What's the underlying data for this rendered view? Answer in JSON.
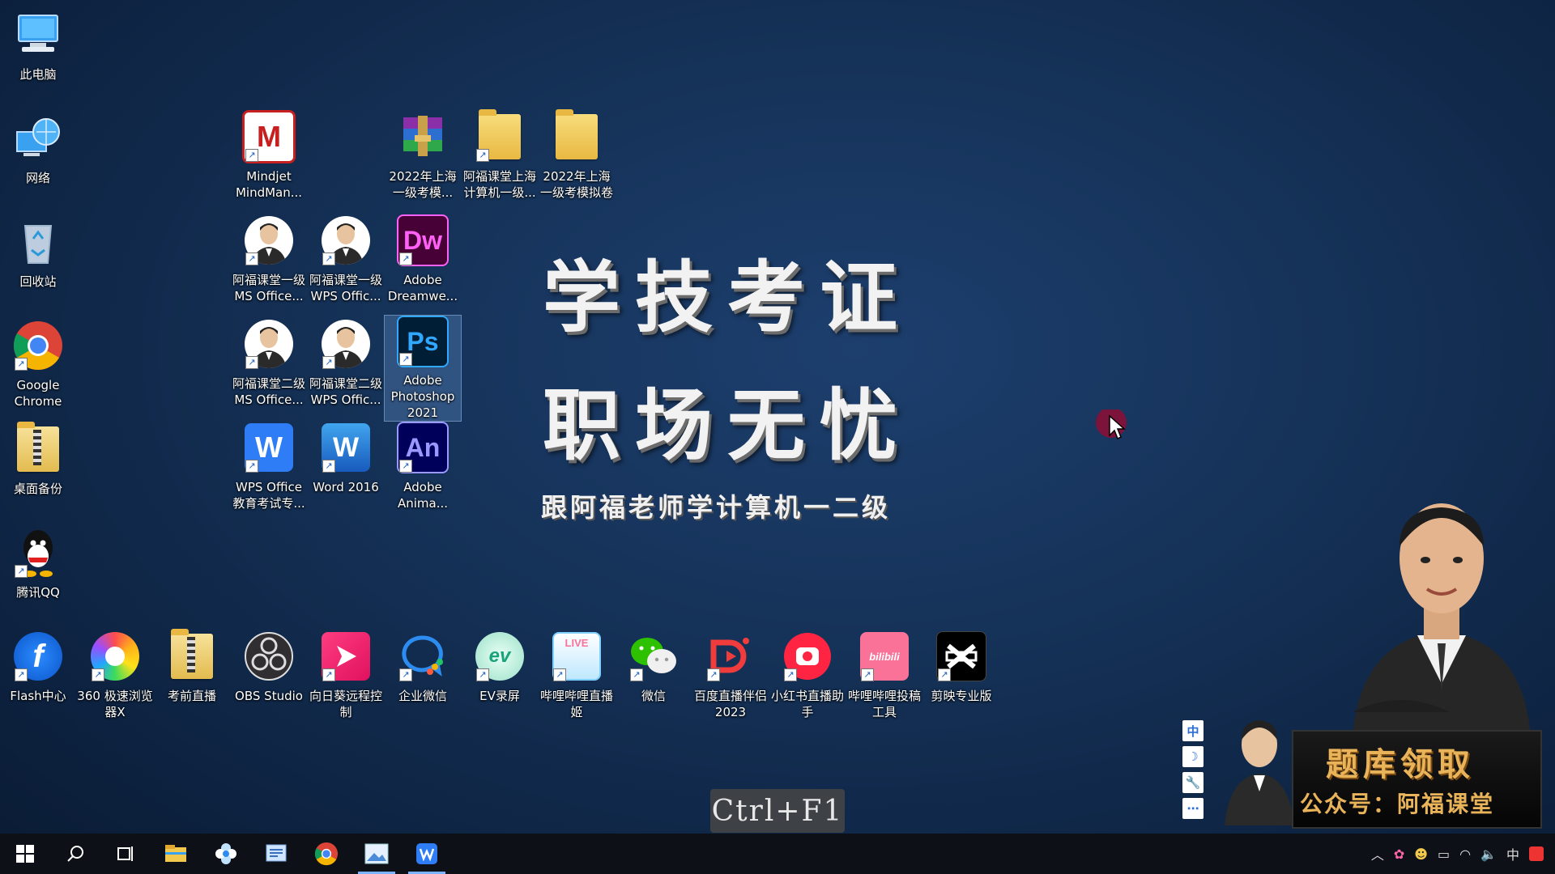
{
  "desktop": {
    "left_column": [
      {
        "label": "此电脑",
        "icon": "computer-icon"
      },
      {
        "label": "网络",
        "icon": "network-icon"
      },
      {
        "label": "回收站",
        "icon": "recycle-bin-icon"
      },
      {
        "label": "Google\nChrome",
        "icon": "chrome-icon"
      },
      {
        "label": "桌面备份",
        "icon": "zip-folder-icon"
      },
      {
        "label": "腾讯QQ",
        "icon": "qq-icon"
      }
    ],
    "grid": [
      {
        "label": "Mindjet\nMindMan...",
        "icon": "mindjet-icon"
      },
      {
        "label": "2022年上海\n一级考模...",
        "icon": "winrar-icon"
      },
      {
        "label": "阿福课堂上海\n计算机一级...",
        "icon": "folder-icon"
      },
      {
        "label": "2022年上海\n一级考模拟卷",
        "icon": "folder-icon"
      },
      {
        "label": "阿福课堂一级\nMS Office...",
        "icon": "teacher-avatar-icon"
      },
      {
        "label": "阿福课堂一级\nWPS Offic...",
        "icon": "teacher-avatar-icon"
      },
      {
        "label": "Adobe\nDreamwe...",
        "icon": "dreamweaver-icon",
        "text": "Dw"
      },
      {
        "label": "阿福课堂二级\nMS Office...",
        "icon": "teacher-avatar-icon"
      },
      {
        "label": "阿福课堂二级\nWPS Offic...",
        "icon": "teacher-avatar-icon"
      },
      {
        "label": "Adobe\nPhotoshop\n2021",
        "icon": "photoshop-icon",
        "text": "Ps"
      },
      {
        "label": "WPS Office\n教育考试专...",
        "icon": "wps-icon",
        "text": "W"
      },
      {
        "label": "Word 2016",
        "icon": "word-icon",
        "text": "W"
      },
      {
        "label": "Adobe\nAnima...",
        "icon": "animate-icon",
        "text": "An"
      }
    ],
    "bottom_row": [
      {
        "label": "Flash中心",
        "icon": "flash-icon"
      },
      {
        "label": "360 极速浏览\n器X",
        "icon": "browser-360-icon"
      },
      {
        "label": "考前直播",
        "icon": "zip-folder-icon"
      },
      {
        "label": "OBS Studio",
        "icon": "obs-icon"
      },
      {
        "label": "向日葵远程控\n制",
        "icon": "sunlogin-icon"
      },
      {
        "label": "企业微信",
        "icon": "wecom-icon"
      },
      {
        "label": "EV录屏",
        "icon": "ev-recorder-icon"
      },
      {
        "label": "哔哩哔哩直播\n姬",
        "icon": "bilibili-live-icon",
        "text": "LIVE"
      },
      {
        "label": "微信",
        "icon": "wechat-icon"
      },
      {
        "label": "百度直播伴侣\n2023",
        "icon": "baidu-live-icon"
      },
      {
        "label": "小红书直播助\n手",
        "icon": "xiaohongshu-icon"
      },
      {
        "label": "哔哩哔哩投稿\n工具",
        "icon": "bilibili-upload-icon",
        "text": "bilibili"
      },
      {
        "label": "剪映专业版",
        "icon": "capcut-icon"
      }
    ]
  },
  "wallpaper": {
    "headline1": "学技考证",
    "headline2": "职场无忧",
    "subline": "跟阿福老师学计算机一二级"
  },
  "overlay": {
    "key_hint": "Ctrl+F1",
    "promo_title": "题库领取",
    "promo_sub": "公众号：阿福课堂",
    "ime_buttons": [
      "中",
      "☽",
      "🔧",
      "⋯"
    ]
  },
  "taskbar": {
    "tray_ime": "中"
  },
  "colors": {
    "accent": "#7ab3ff",
    "promo_gold": "#e9b35a"
  }
}
